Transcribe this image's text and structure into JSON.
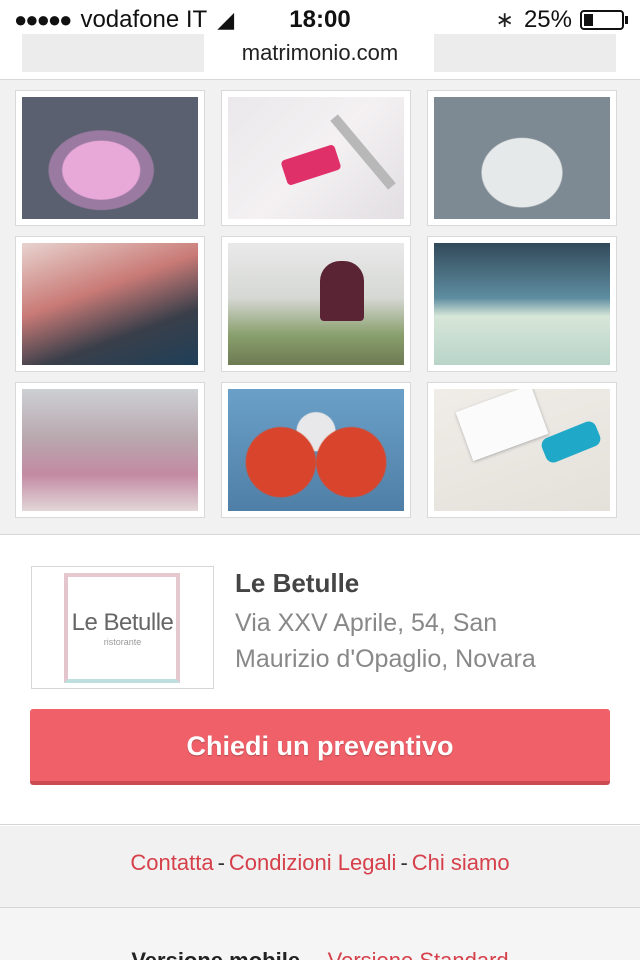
{
  "status_bar": {
    "carrier": "vodafone IT",
    "signal_dots": "●●●●●",
    "time": "18:00",
    "battery": "25%",
    "battery_level": 0.25,
    "url": "matrimonio.com"
  },
  "gallery": {
    "photos": [
      {
        "subject": "round table with pink decor"
      },
      {
        "subject": "place setting with pink ribbon"
      },
      {
        "subject": "white round table"
      },
      {
        "subject": "buffet plates"
      },
      {
        "subject": "chocolate fountain"
      },
      {
        "subject": "buffet table with drinks"
      },
      {
        "subject": "ceremony aisle"
      },
      {
        "subject": "heart-shaped pizza"
      },
      {
        "subject": "invitation with blue ribbon"
      }
    ]
  },
  "venue": {
    "logo_name": "Le Betulle",
    "logo_subtitle": "ristorante",
    "name": "Le Betulle",
    "address": "Via XXV Aprile, 54, San Maurizio d'Opaglio, Novara",
    "cta_label": "Chiedi un preventivo"
  },
  "footer": {
    "links": [
      "Contatta",
      "Condizioni Legali",
      "Chi siamo"
    ],
    "separator": "-",
    "mobile_label": "Versione mobile",
    "standard_label": "Versione Standard"
  },
  "colors": {
    "accent": "#ef6068",
    "link": "#d6404a"
  }
}
